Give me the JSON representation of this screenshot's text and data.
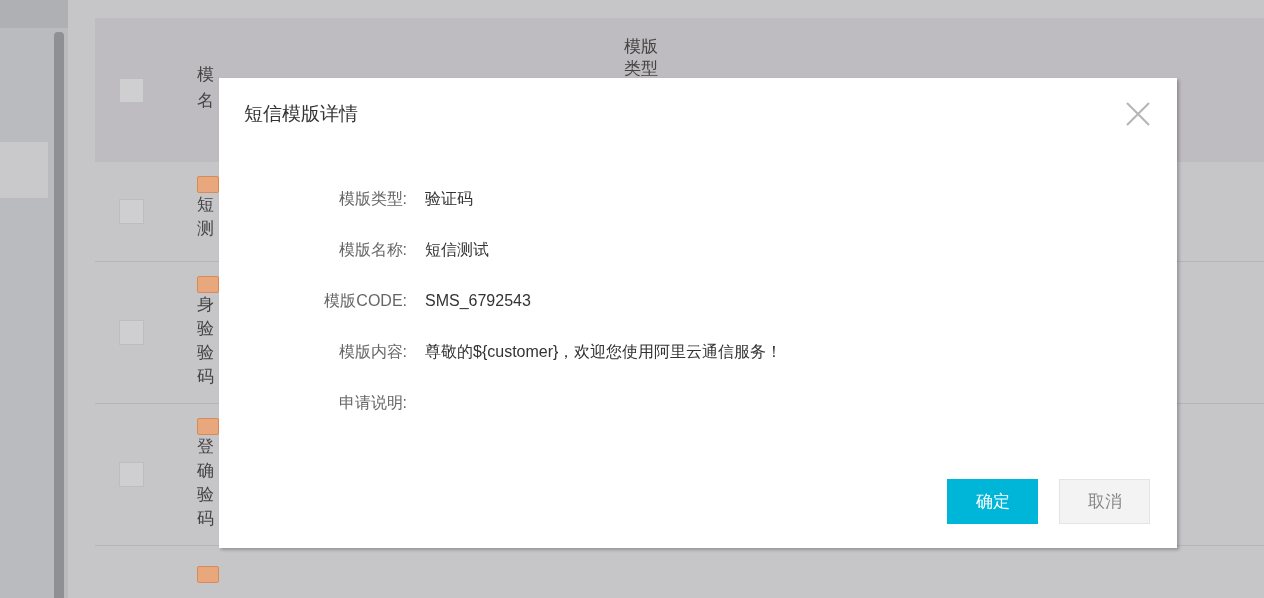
{
  "table": {
    "header": {
      "checked": false,
      "column_1": [
        "模",
        "名"
      ],
      "column_3": [
        "模版",
        "类型"
      ]
    },
    "rows": [
      {
        "checked": false,
        "tag": true,
        "lines": [
          "短",
          "测"
        ]
      },
      {
        "checked": false,
        "tag": true,
        "lines": [
          "身",
          "验",
          "验",
          "码"
        ]
      },
      {
        "checked": false,
        "tag": true,
        "lines": [
          "登",
          "确",
          "验",
          "码"
        ]
      },
      {
        "tag": true,
        "lines": []
      }
    ]
  },
  "dialog": {
    "title": "短信模版详情",
    "fields": [
      {
        "label": "模版类型:",
        "value": "验证码"
      },
      {
        "label": "模版名称:",
        "value": "短信测试"
      },
      {
        "label": "模版CODE:",
        "value": "SMS_6792543"
      },
      {
        "label": "模版内容:",
        "value": "尊敬的${customer}，欢迎您使用阿里云通信服务！"
      },
      {
        "label": "申请说明:"
      }
    ],
    "buttons": [
      {
        "label": "确定",
        "kind": "primary"
      },
      {
        "label": "取消",
        "kind": "secondary"
      }
    ]
  }
}
